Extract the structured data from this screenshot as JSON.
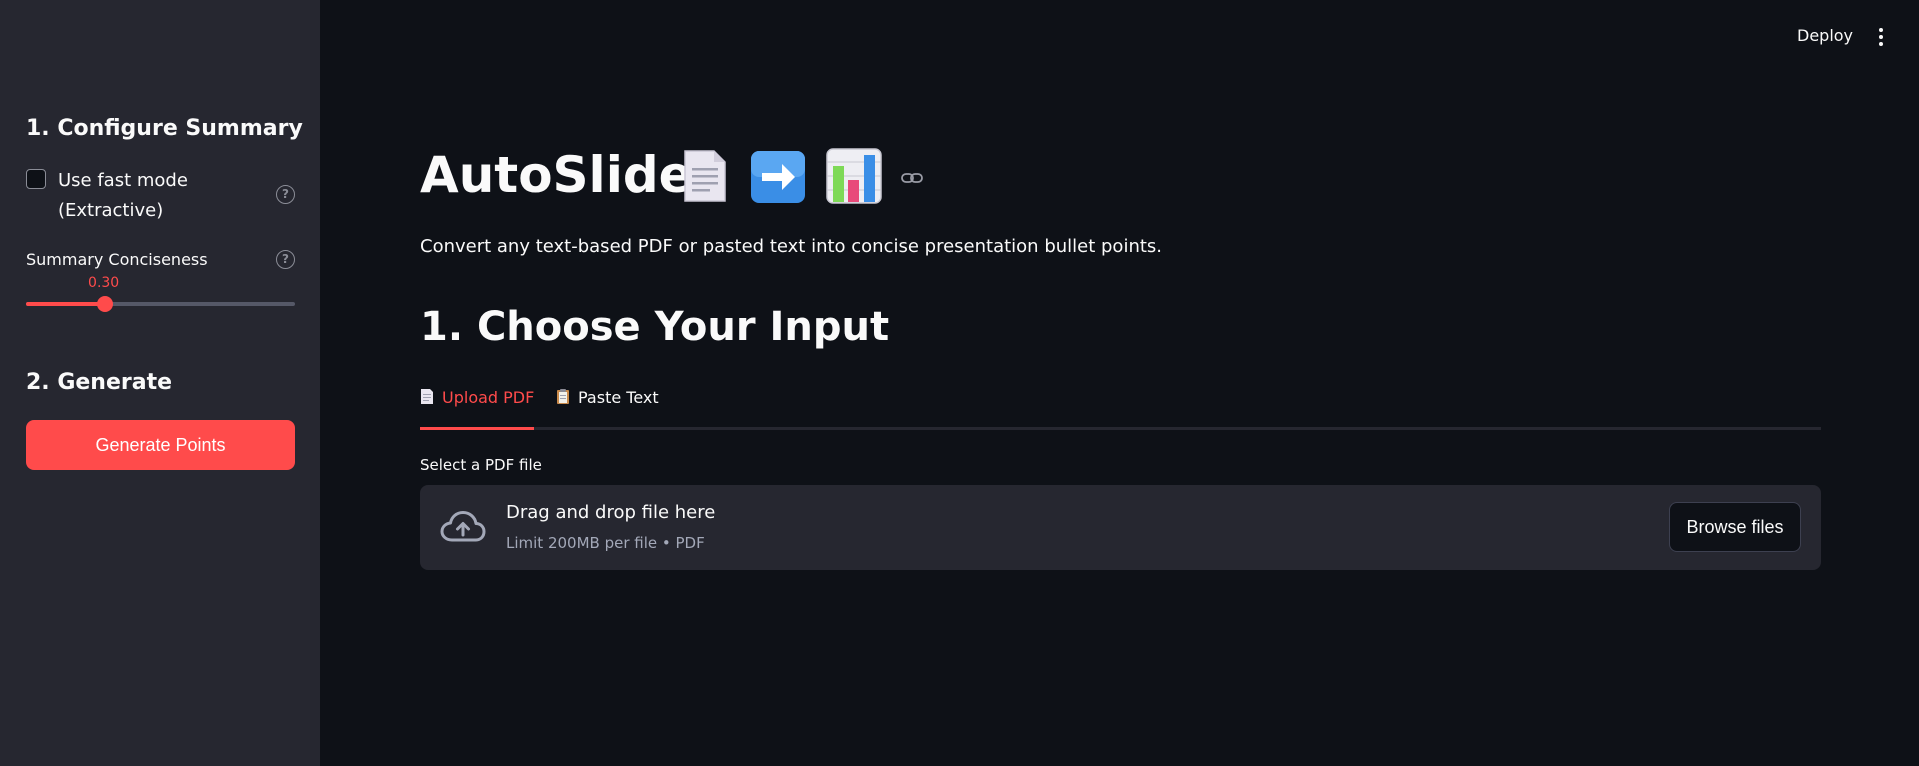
{
  "header": {
    "deploy_label": "Deploy",
    "menu_icon": "vertical-ellipsis-icon"
  },
  "sidebar": {
    "section1_title": "1. Configure Summary",
    "fast_mode": {
      "label": "Use fast mode (Extractive)",
      "checked": false
    },
    "conciseness": {
      "label": "Summary Conciseness",
      "value": 0.3,
      "value_text": "0.30"
    },
    "section2_title": "2. Generate",
    "generate_button": "Generate Points"
  },
  "main": {
    "title": "AutoSlide",
    "title_emojis": [
      "page-emoji-icon",
      "right-arrow-emoji-icon",
      "bar-chart-emoji-icon"
    ],
    "subtitle": "Convert any text-based PDF or pasted text into concise presentation bullet points.",
    "section_title": "1. Choose Your Input",
    "tabs": [
      {
        "label": "Upload PDF",
        "icon": "page-emoji-icon",
        "active": true
      },
      {
        "label": "Paste Text",
        "icon": "clipboard-emoji-icon",
        "active": false
      }
    ],
    "file_uploader": {
      "label": "Select a PDF file",
      "drop_title": "Drag and drop file here",
      "limit_text": "Limit 200MB per file • PDF",
      "browse_label": "Browse files"
    }
  },
  "colors": {
    "accent": "#ff4b4b",
    "background": "#0e1117",
    "sidebar": "#262730"
  }
}
